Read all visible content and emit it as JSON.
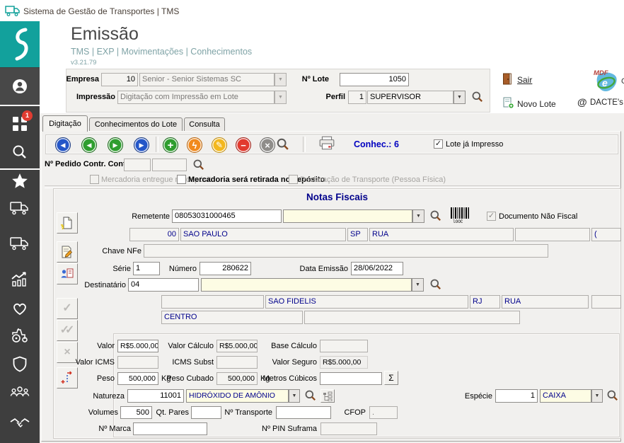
{
  "window": {
    "title": "Sistema de Gestão de Transportes | TMS"
  },
  "sidebar": {
    "badge": "1",
    "icons": [
      "senior-logo",
      "user",
      "apps",
      "search",
      "favorites",
      "truck-outbound",
      "truck-inbound",
      "performance",
      "health",
      "equipment",
      "security",
      "fleet-group",
      "partnership"
    ]
  },
  "header": {
    "title": "Emissão",
    "breadcrumb": "TMS | EXP | Movimentações | Conhecimentos",
    "version": "v3.21.79"
  },
  "top_form": {
    "empresa": {
      "label": "Empresa",
      "code": "10",
      "name": "Senior - Senior Sistemas SC"
    },
    "impressao": {
      "label": "Impressão",
      "value": "Digitação com Impressão em Lote"
    },
    "lote": {
      "label": "Nº Lote",
      "value": "1050"
    },
    "perfil": {
      "label": "Perfil",
      "code": "1",
      "name": "SUPERVISOR"
    },
    "actions": {
      "sair": "Sair",
      "novo_lote": "Novo Lote",
      "mdfe": "MDF",
      "mdfe_e": "e",
      "mdfe_cut": "C",
      "dacte_at": "@",
      "dacte": "DACTE's"
    }
  },
  "tabs": {
    "digitacao": "Digitação",
    "conhecimentos": "Conhecimentos do Lote",
    "consulta": "Consulta"
  },
  "toolbar": {
    "icons": [
      "first",
      "previous",
      "next",
      "last",
      "add",
      "execute",
      "edit",
      "delete",
      "cancel",
      "search",
      "print"
    ],
    "conhec": "Conhec.: 6",
    "lote_impresso": "Lote já Impresso"
  },
  "pedido": {
    "label": "Nº Pedido Contr. Container",
    "field1": "",
    "field2": ""
  },
  "flags": {
    "entregue": "Mercadoria entregue no depósito",
    "retirada": "Mercadoria será retirada no depósito",
    "declaracao": "Declaração de Transporte (Pessoa Física)"
  },
  "notas": {
    "title": "Notas Fiscais",
    "remetente": {
      "label": "Remetente",
      "code": "08053031000465",
      "name": "",
      "doc_flag": "Documento Não Fiscal"
    },
    "rem_end": {
      "cod": "00",
      "cidade": "SAO PAULO",
      "uf": "SP",
      "logradouro": "RUA",
      "rua_nome": "",
      "extra": "("
    },
    "chave": {
      "label": "Chave NFe",
      "value": ""
    },
    "serie": {
      "label": "Série",
      "value": "1"
    },
    "numero": {
      "label": "Número",
      "value": "280622"
    },
    "emissao": {
      "label": "Data Emissão",
      "value": "28/06/2022"
    },
    "destinatario": {
      "label": "Destinatário",
      "code": "04",
      "name": ""
    },
    "dest_end": {
      "cod": "",
      "cidade": "SAO FIDELIS",
      "uf": "RJ",
      "logradouro": "RUA",
      "extra": "",
      "bairro": "CENTRO",
      "compl": ""
    },
    "valores": {
      "valor": {
        "label": "Valor",
        "value": "R$5.000,00"
      },
      "valor_calculo": {
        "label": "Valor Cálculo",
        "value": "R$5.000,00"
      },
      "base_calculo": {
        "label": "Base Cálculo",
        "value": ""
      },
      "valor_icms": {
        "label": "Valor ICMS",
        "value": ""
      },
      "icms_subst": {
        "label": "ICMS Subst",
        "value": ""
      },
      "valor_seguro": {
        "label": "Valor Seguro",
        "value": "R$5.000,00"
      },
      "peso": {
        "label": "Peso",
        "value": "500,000",
        "unit": "Kg"
      },
      "peso_cubado": {
        "label": "Peso Cubado",
        "value": "500,000",
        "unit": "Kg"
      },
      "metros": {
        "label": "Metros Cúbicos",
        "value": "",
        "sigma": "Σ"
      },
      "natureza": {
        "label": "Natureza",
        "code": "11001",
        "name": "HIDRÓXIDO DE AMÔNIO"
      },
      "especie": {
        "label": "Espécie",
        "code": "1",
        "name": "CAIXA"
      },
      "volumes": {
        "label": "Volumes",
        "value": "500"
      },
      "qt_pares": {
        "label": "Qt. Pares",
        "value": ""
      },
      "n_transporte": {
        "label": "Nº Transporte",
        "value": ""
      },
      "cfop": {
        "label": "CFOP",
        "value": "."
      },
      "n_marca": {
        "label": "Nº Marca",
        "value": ""
      },
      "pin_suframa": {
        "label": "Nº PIN Suframa",
        "value": ""
      }
    }
  },
  "colors": {
    "teal": "#12a19c",
    "navy": "#00008b",
    "sidebar": "#3e3e3e",
    "badge_red": "#e03c31"
  }
}
